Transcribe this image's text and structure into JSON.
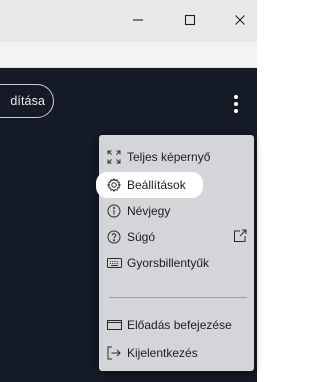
{
  "window": {
    "minimize_icon": "minimize-icon",
    "maximize_icon": "maximize-icon",
    "close_icon": "close-icon"
  },
  "app": {
    "pill_button_label": "dítása",
    "menu_button_icon": "kebab-menu-icon"
  },
  "menu": {
    "items": [
      {
        "label": "Teljes képernyő",
        "icon": "fullscreen-icon"
      },
      {
        "label": "Beállítások",
        "icon": "gear-icon",
        "highlighted": true
      },
      {
        "label": "Névjegy",
        "icon": "info-icon"
      },
      {
        "label": "Súgó",
        "icon": "help-icon",
        "trailing_icon": "external-link-icon"
      },
      {
        "label": "Gyorsbillentyűk",
        "icon": "keyboard-icon"
      },
      {
        "label": "Előadás befejezése",
        "icon": "end-presentation-icon"
      },
      {
        "label": "Kijelentkezés",
        "icon": "logout-icon"
      }
    ]
  },
  "colors": {
    "app_background": "#141a26",
    "menu_background": "#d4d5d8",
    "highlight_background": "#ffffff",
    "titlebar_background": "#e8e8e8"
  }
}
